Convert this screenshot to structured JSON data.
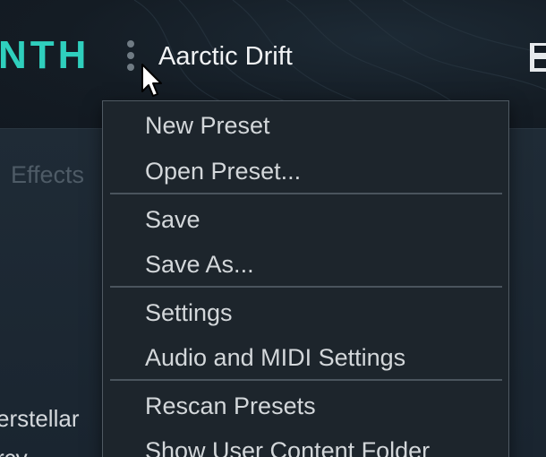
{
  "app": {
    "logo_text": "NTH",
    "preset_name": "Aarctic Drift",
    "colors": {
      "accent": "#2fcfbd",
      "background": "#1b2530",
      "menu_background": "#1d252c",
      "menu_text": "#d3d7da"
    }
  },
  "header": {
    "menu_icon": "kebab-menu-icon",
    "save_icon": "save-icon"
  },
  "panel": {
    "tab_effects": "Effects",
    "list_items": [
      "erstellar",
      "rcy"
    ]
  },
  "preset_menu": {
    "groups": [
      [
        "New Preset",
        "Open Preset..."
      ],
      [
        "Save",
        "Save As..."
      ],
      [
        "Settings",
        "Audio and MIDI Settings"
      ],
      [
        "Rescan Presets",
        "Show User Content Folder"
      ]
    ]
  }
}
